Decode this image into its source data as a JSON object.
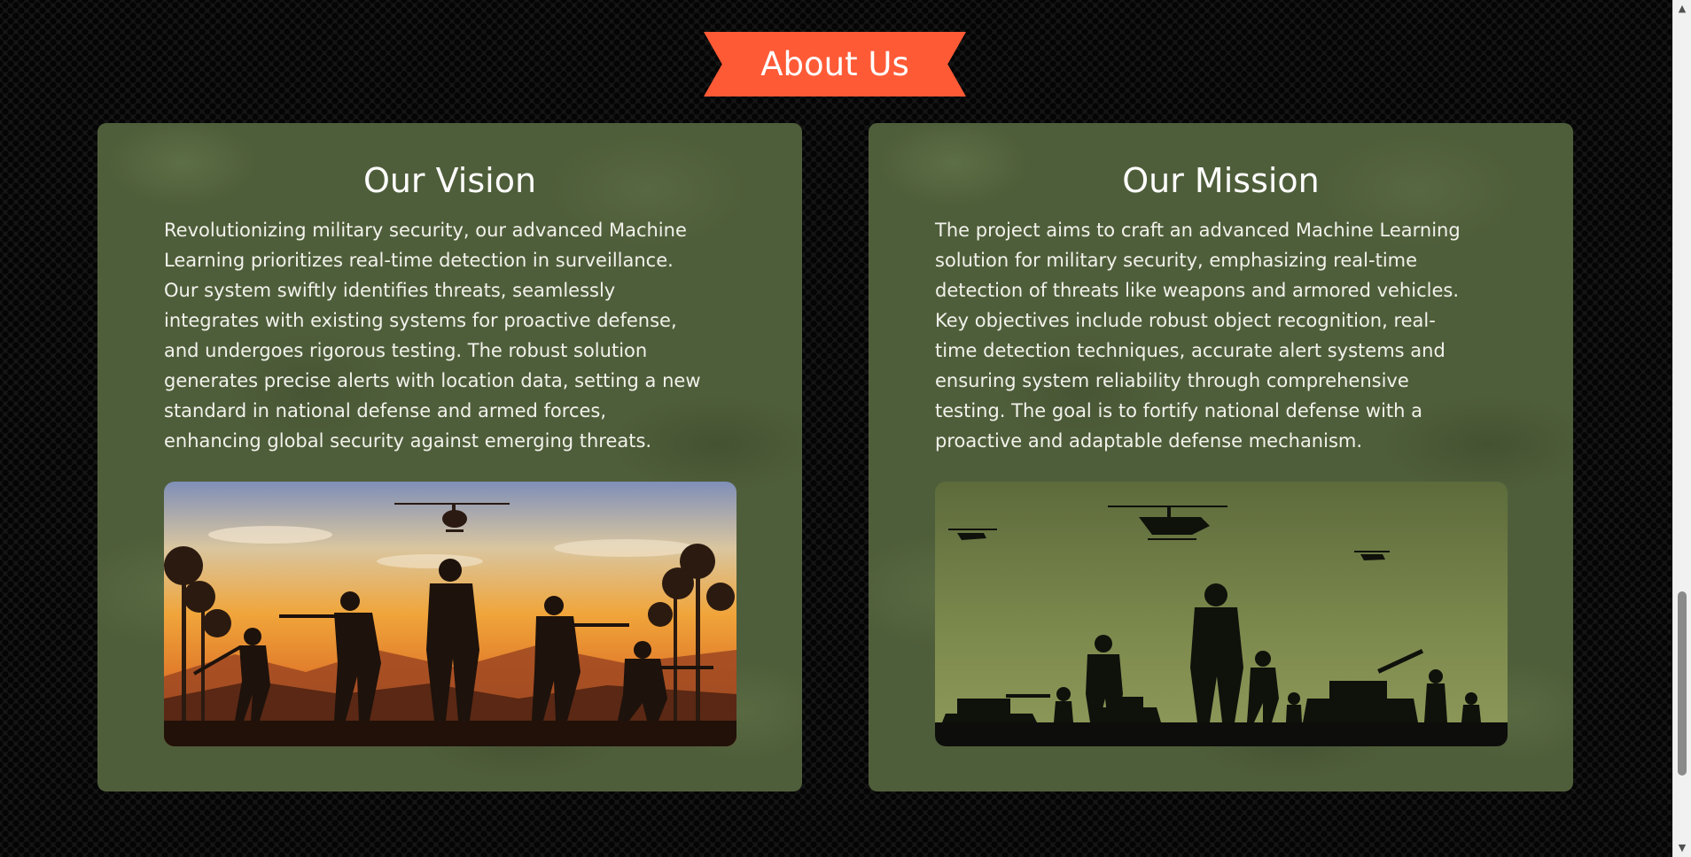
{
  "section": {
    "title": "About Us",
    "accent_color": "#ff5a36"
  },
  "cards": [
    {
      "title": "Our Vision",
      "lines": [
        "Revolutionizing military security, our advanced Machine",
        "Learning prioritizes real-time detection in surveillance.",
        "Our system swiftly identifies threats, seamlessly",
        "integrates with existing systems for proactive defense,",
        "and undergoes rigorous testing. The robust solution",
        "generates precise alerts with location data, setting a new",
        "standard in national defense and armed forces,",
        "enhancing global security against emerging threats."
      ],
      "image_icon": "soldiers-sunset-silhouette-illustration"
    },
    {
      "title": "Our Mission",
      "lines": [
        "The project aims to craft an advanced Machine Learning",
        "solution for military security, emphasizing real-time",
        "detection of threats like weapons and armored vehicles.",
        "Key objectives include robust object recognition, real-",
        "time detection techniques, accurate alert systems and",
        "ensuring system reliability through comprehensive",
        "testing. The goal is to fortify national defense with a",
        "proactive and adaptable defense mechanism."
      ],
      "image_icon": "soldiers-tanks-helicopters-silhouette-illustration"
    }
  ],
  "scrollbar": {
    "up_icon": "chevron-up-icon",
    "down_icon": "chevron-down-icon"
  }
}
